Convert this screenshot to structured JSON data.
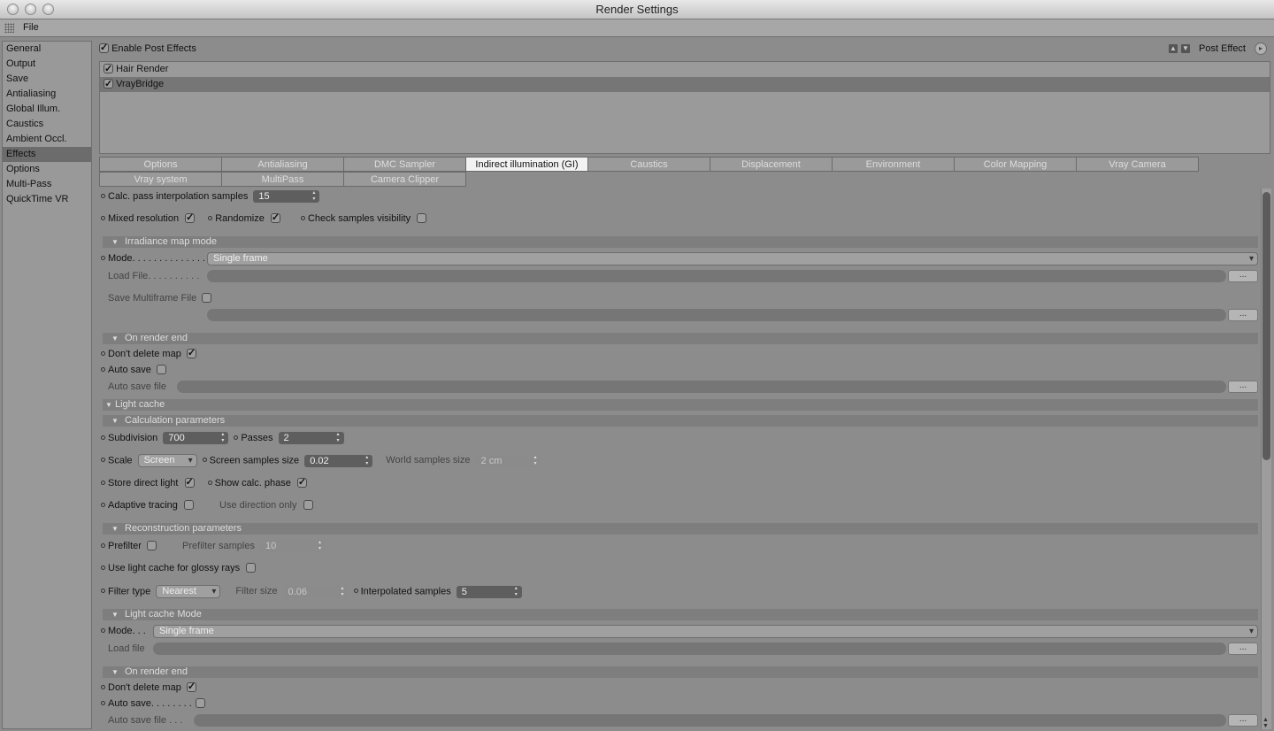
{
  "window": {
    "title": "Render Settings"
  },
  "menu": {
    "file": "File"
  },
  "sidebar": {
    "items": [
      "General",
      "Output",
      "Save",
      "Antialiasing",
      "Global Illum.",
      "Caustics",
      "Ambient Occl.",
      "Effects",
      "Options",
      "Multi-Pass",
      "QuickTime VR"
    ],
    "active": "Effects"
  },
  "post_effects": {
    "enable_label": "Enable Post Effects",
    "enable_checked": true,
    "post_effect_label": "Post Effect",
    "list": [
      {
        "name": "Hair Render",
        "checked": true
      },
      {
        "name": "VrayBridge",
        "checked": true
      }
    ]
  },
  "tabs": {
    "row1": [
      "Options",
      "Antialiasing",
      "DMC Sampler",
      "Indirect illumination (GI)",
      "Caustics",
      "Displacement",
      "Environment",
      "Color Mapping",
      "Vray Camera"
    ],
    "row2": [
      "Vray system",
      "MultiPass",
      "Camera Clipper"
    ],
    "active": "Indirect illumination (GI)"
  },
  "gi": {
    "calc_pass_label": "Calc. pass interpolation samples",
    "calc_pass_value": "15",
    "mixed_resolution_label": "Mixed resolution",
    "randomize_label": "Randomize",
    "check_samples_label": "Check samples visibility",
    "irradiance_section": "Irradiance map mode",
    "mode_label": "Mode. . . . . . . . . . . . . .",
    "mode_value": "Single frame",
    "load_file_label": "Load File. . . . . . . . . .",
    "save_multiframe_label": "Save Multiframe File",
    "on_render_end_section": "On render end",
    "dont_delete_label": "Don't delete map",
    "auto_save_label": "Auto save",
    "auto_save_file_label": "Auto save file",
    "browse": "...",
    "light_cache_section": "Light cache",
    "calc_params_section": "Calculation parameters",
    "subdivision_label": "Subdivision",
    "subdivision_value": "700",
    "passes_label": "Passes",
    "passes_value": "2",
    "scale_label": "Scale",
    "scale_value": "Screen",
    "screen_samples_label": "Screen samples size",
    "screen_samples_value": "0.02",
    "world_samples_label": "World samples size",
    "world_samples_value": "2 cm",
    "store_direct_label": "Store direct light",
    "show_calc_label": "Show calc. phase",
    "adaptive_label": "Adaptive tracing",
    "use_direction_label": "Use direction only",
    "recon_section": "Reconstruction parameters",
    "prefilter_label": "Prefilter",
    "prefilter_samples_label": "Prefilter samples",
    "prefilter_samples_value": "10",
    "glossy_label": "Use light cache for glossy rays",
    "filter_type_label": "Filter type",
    "filter_type_value": "Nearest",
    "filter_size_label": "Filter size",
    "filter_size_value": "0.06",
    "interp_samples_label": "Interpolated samples",
    "interp_samples_value": "5",
    "lc_mode_section": "Light cache Mode",
    "lc_mode_label": "Mode. . .",
    "lc_mode_value": "Single frame",
    "lc_load_file_label": "Load file",
    "lc_on_render_end_section": "On render end",
    "lc_dont_delete_label": "Don't delete map",
    "lc_auto_save_label": "Auto save. . . . . . . .",
    "lc_auto_save_file_label": "Auto save file . . ."
  }
}
